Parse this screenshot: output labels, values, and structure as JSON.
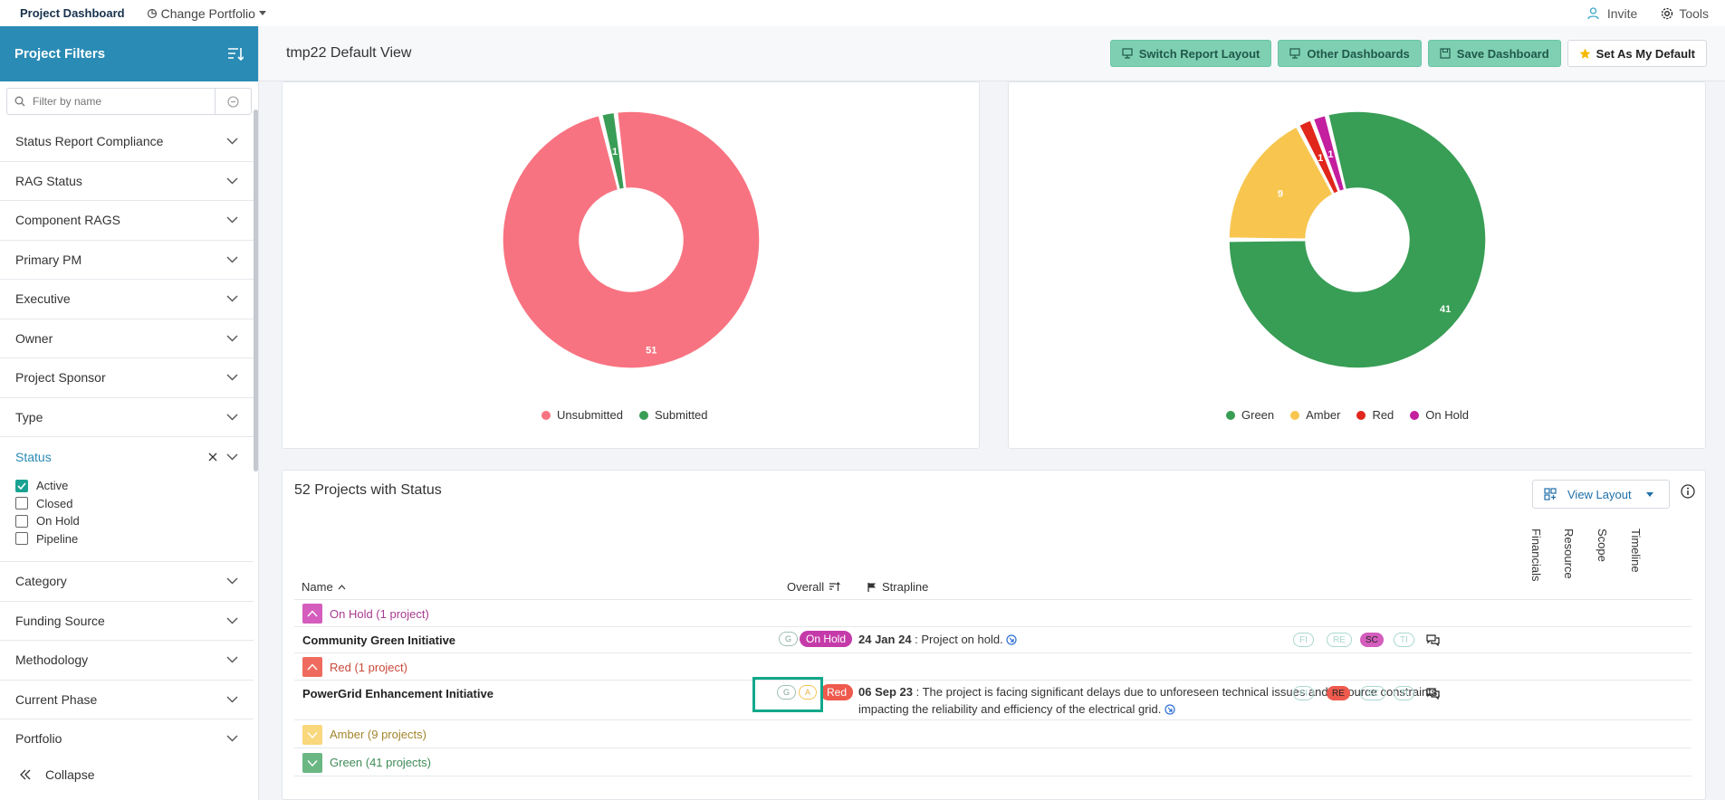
{
  "topnav": {
    "dashboard": "Project Dashboard",
    "portfolio": "Change Portfolio",
    "invite": "Invite",
    "tools": "Tools"
  },
  "sidebar": {
    "title": "Project Filters",
    "search_placeholder": "Filter by name",
    "filters_top": [
      "Status Report Compliance",
      "RAG Status",
      "Component RAGS",
      "Primary PM",
      "Executive",
      "Owner",
      "Project Sponsor",
      "Type"
    ],
    "status": {
      "label": "Status",
      "options": [
        {
          "label": "Active",
          "checked": true
        },
        {
          "label": "Closed",
          "checked": false
        },
        {
          "label": "On Hold",
          "checked": false
        },
        {
          "label": "Pipeline",
          "checked": false
        }
      ]
    },
    "filters_bottom": [
      "Category",
      "Funding Source",
      "Methodology",
      "Current Phase",
      "Portfolio"
    ],
    "collapse": "Collapse"
  },
  "header": {
    "view_title": "tmp22 Default View",
    "switch_layout": "Switch Report Layout",
    "other_dashboards": "Other Dashboards",
    "save_dashboard": "Save Dashboard",
    "set_default": "Set As My Default"
  },
  "chart_data": [
    {
      "type": "pie",
      "donut": true,
      "categories": [
        "Unsubmitted",
        "Submitted"
      ],
      "values": [
        51,
        1
      ],
      "colors": [
        "#f87381",
        "#3a9d56"
      ],
      "legend": "bottom"
    },
    {
      "type": "pie",
      "donut": true,
      "categories": [
        "Green",
        "Amber",
        "Red",
        "On Hold"
      ],
      "values": [
        41,
        9,
        1,
        1
      ],
      "colors": [
        "#389d55",
        "#f8c64f",
        "#e1261c",
        "#c41f9e"
      ],
      "legend": "bottom"
    }
  ],
  "table": {
    "title": "52 Projects with Status",
    "view_layout": "View Layout",
    "col_name": "Name",
    "col_overall": "Overall",
    "col_strapline": "Strapline",
    "col_vertical": [
      "Financials",
      "Resource",
      "Scope",
      "Timeline"
    ],
    "groups": {
      "onhold": "On Hold (1 project)",
      "red": "Red (1 project)",
      "amber": "Amber (9 projects)",
      "green": "Green (41 projects)"
    },
    "projects": [
      {
        "name": "Community Green Initiative",
        "small_pills": [
          "G"
        ],
        "status": "On Hold",
        "date": "24 Jan 24",
        "strapline": " : Project on hold.",
        "chips": [
          "FI",
          "RE",
          "SC",
          "TI"
        ],
        "active_chip": "SC"
      },
      {
        "name": "PowerGrid Enhancement Initiative",
        "small_pills": [
          "G",
          "A"
        ],
        "status": "Red",
        "date": "06 Sep 23",
        "strapline": " : The project is facing significant delays due to unforeseen technical issues and resource constraints, impacting the reliability and efficiency of the electrical grid.",
        "chips": [
          "FI",
          "RE",
          "SC",
          "TI"
        ],
        "active_chip": "RE"
      }
    ]
  }
}
